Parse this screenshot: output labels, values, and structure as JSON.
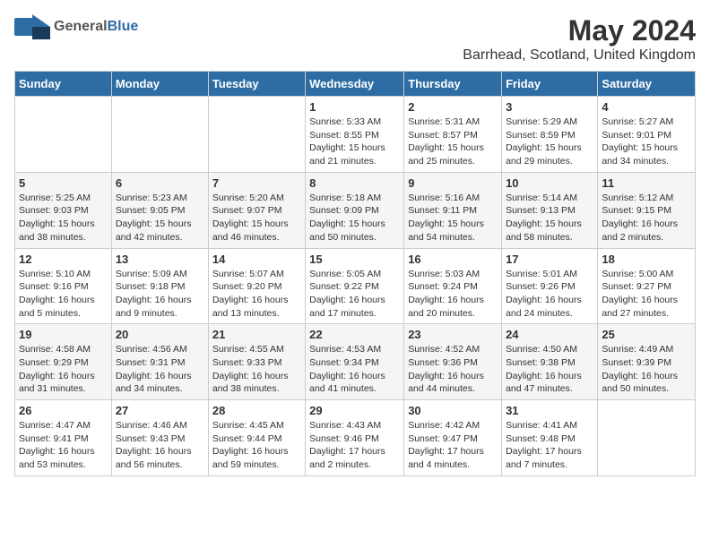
{
  "header": {
    "logo_general": "General",
    "logo_blue": "Blue",
    "month": "May 2024",
    "location": "Barrhead, Scotland, United Kingdom"
  },
  "days_of_week": [
    "Sunday",
    "Monday",
    "Tuesday",
    "Wednesday",
    "Thursday",
    "Friday",
    "Saturday"
  ],
  "weeks": [
    [
      {
        "day": "",
        "info": ""
      },
      {
        "day": "",
        "info": ""
      },
      {
        "day": "",
        "info": ""
      },
      {
        "day": "1",
        "info": "Sunrise: 5:33 AM\nSunset: 8:55 PM\nDaylight: 15 hours\nand 21 minutes."
      },
      {
        "day": "2",
        "info": "Sunrise: 5:31 AM\nSunset: 8:57 PM\nDaylight: 15 hours\nand 25 minutes."
      },
      {
        "day": "3",
        "info": "Sunrise: 5:29 AM\nSunset: 8:59 PM\nDaylight: 15 hours\nand 29 minutes."
      },
      {
        "day": "4",
        "info": "Sunrise: 5:27 AM\nSunset: 9:01 PM\nDaylight: 15 hours\nand 34 minutes."
      }
    ],
    [
      {
        "day": "5",
        "info": "Sunrise: 5:25 AM\nSunset: 9:03 PM\nDaylight: 15 hours\nand 38 minutes."
      },
      {
        "day": "6",
        "info": "Sunrise: 5:23 AM\nSunset: 9:05 PM\nDaylight: 15 hours\nand 42 minutes."
      },
      {
        "day": "7",
        "info": "Sunrise: 5:20 AM\nSunset: 9:07 PM\nDaylight: 15 hours\nand 46 minutes."
      },
      {
        "day": "8",
        "info": "Sunrise: 5:18 AM\nSunset: 9:09 PM\nDaylight: 15 hours\nand 50 minutes."
      },
      {
        "day": "9",
        "info": "Sunrise: 5:16 AM\nSunset: 9:11 PM\nDaylight: 15 hours\nand 54 minutes."
      },
      {
        "day": "10",
        "info": "Sunrise: 5:14 AM\nSunset: 9:13 PM\nDaylight: 15 hours\nand 58 minutes."
      },
      {
        "day": "11",
        "info": "Sunrise: 5:12 AM\nSunset: 9:15 PM\nDaylight: 16 hours\nand 2 minutes."
      }
    ],
    [
      {
        "day": "12",
        "info": "Sunrise: 5:10 AM\nSunset: 9:16 PM\nDaylight: 16 hours\nand 5 minutes."
      },
      {
        "day": "13",
        "info": "Sunrise: 5:09 AM\nSunset: 9:18 PM\nDaylight: 16 hours\nand 9 minutes."
      },
      {
        "day": "14",
        "info": "Sunrise: 5:07 AM\nSunset: 9:20 PM\nDaylight: 16 hours\nand 13 minutes."
      },
      {
        "day": "15",
        "info": "Sunrise: 5:05 AM\nSunset: 9:22 PM\nDaylight: 16 hours\nand 17 minutes."
      },
      {
        "day": "16",
        "info": "Sunrise: 5:03 AM\nSunset: 9:24 PM\nDaylight: 16 hours\nand 20 minutes."
      },
      {
        "day": "17",
        "info": "Sunrise: 5:01 AM\nSunset: 9:26 PM\nDaylight: 16 hours\nand 24 minutes."
      },
      {
        "day": "18",
        "info": "Sunrise: 5:00 AM\nSunset: 9:27 PM\nDaylight: 16 hours\nand 27 minutes."
      }
    ],
    [
      {
        "day": "19",
        "info": "Sunrise: 4:58 AM\nSunset: 9:29 PM\nDaylight: 16 hours\nand 31 minutes."
      },
      {
        "day": "20",
        "info": "Sunrise: 4:56 AM\nSunset: 9:31 PM\nDaylight: 16 hours\nand 34 minutes."
      },
      {
        "day": "21",
        "info": "Sunrise: 4:55 AM\nSunset: 9:33 PM\nDaylight: 16 hours\nand 38 minutes."
      },
      {
        "day": "22",
        "info": "Sunrise: 4:53 AM\nSunset: 9:34 PM\nDaylight: 16 hours\nand 41 minutes."
      },
      {
        "day": "23",
        "info": "Sunrise: 4:52 AM\nSunset: 9:36 PM\nDaylight: 16 hours\nand 44 minutes."
      },
      {
        "day": "24",
        "info": "Sunrise: 4:50 AM\nSunset: 9:38 PM\nDaylight: 16 hours\nand 47 minutes."
      },
      {
        "day": "25",
        "info": "Sunrise: 4:49 AM\nSunset: 9:39 PM\nDaylight: 16 hours\nand 50 minutes."
      }
    ],
    [
      {
        "day": "26",
        "info": "Sunrise: 4:47 AM\nSunset: 9:41 PM\nDaylight: 16 hours\nand 53 minutes."
      },
      {
        "day": "27",
        "info": "Sunrise: 4:46 AM\nSunset: 9:43 PM\nDaylight: 16 hours\nand 56 minutes."
      },
      {
        "day": "28",
        "info": "Sunrise: 4:45 AM\nSunset: 9:44 PM\nDaylight: 16 hours\nand 59 minutes."
      },
      {
        "day": "29",
        "info": "Sunrise: 4:43 AM\nSunset: 9:46 PM\nDaylight: 17 hours\nand 2 minutes."
      },
      {
        "day": "30",
        "info": "Sunrise: 4:42 AM\nSunset: 9:47 PM\nDaylight: 17 hours\nand 4 minutes."
      },
      {
        "day": "31",
        "info": "Sunrise: 4:41 AM\nSunset: 9:48 PM\nDaylight: 17 hours\nand 7 minutes."
      },
      {
        "day": "",
        "info": ""
      }
    ]
  ]
}
